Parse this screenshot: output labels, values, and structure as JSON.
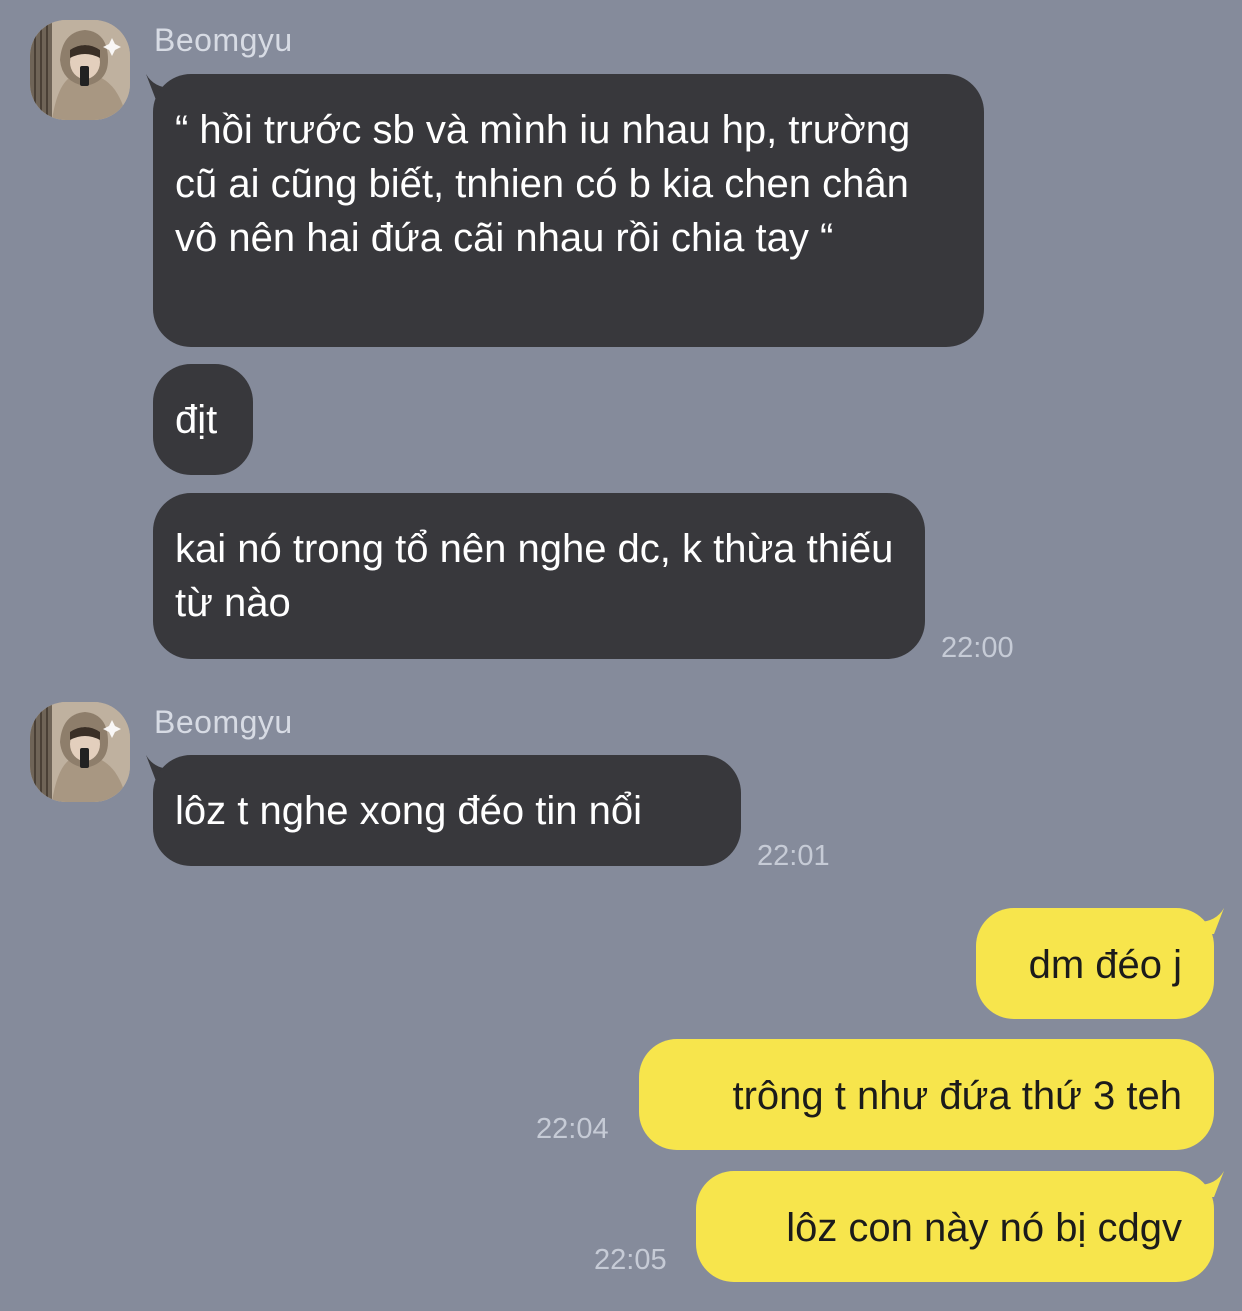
{
  "colors": {
    "background": "#858b9b",
    "incoming_bubble": "#38383c",
    "outgoing_bubble": "#f7e54c",
    "sender_name": "#d7dbe4",
    "timestamp": "#c6cbd6"
  },
  "groups": [
    {
      "sender": "Beomgyu",
      "avatar_icon": "profile-photo",
      "messages": [
        "“ hồi trước sb và mình iu nhau hp, trường cũ ai cũng biết, tnhien có b kia chen chân vô nên hai đứa cãi nhau rồi chia tay “",
        "địt",
        "kai nó trong tổ nên nghe dc, k thừa thiếu từ nào"
      ],
      "time": "22:00"
    },
    {
      "sender": "Beomgyu",
      "avatar_icon": "profile-photo",
      "messages": [
        "lôz t nghe xong đéo tin nổi"
      ],
      "time": "22:01"
    }
  ],
  "outgoing": [
    {
      "text": "dm đéo j",
      "time": ""
    },
    {
      "text": "trông t như đứa thứ 3 teh",
      "time": "22:04"
    },
    {
      "text": "lôz con này nó bị cdgv",
      "time": "22:05"
    }
  ]
}
